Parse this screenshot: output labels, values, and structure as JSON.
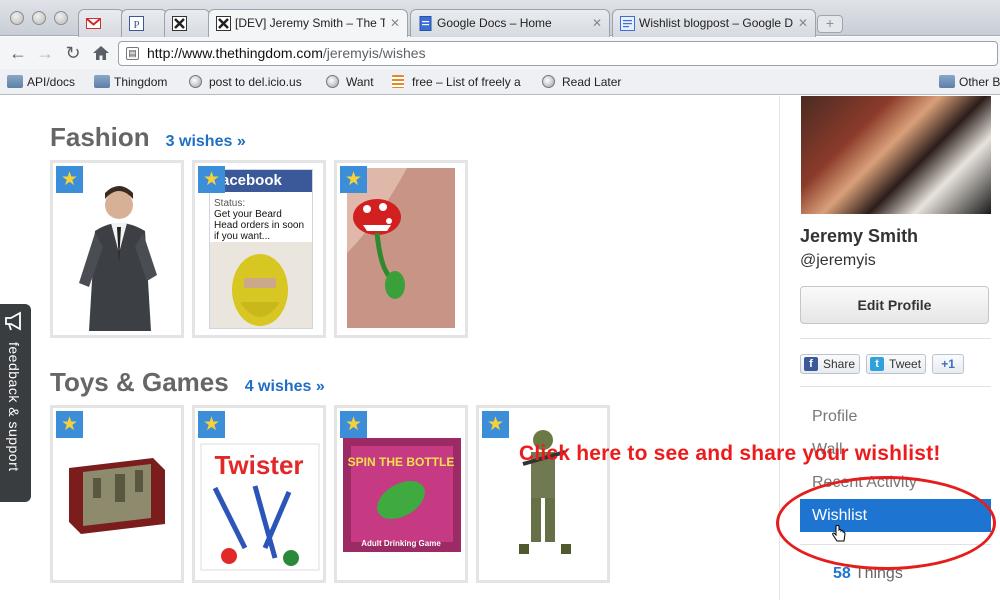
{
  "browser": {
    "tabs": [
      {
        "title": "",
        "icon": "gmail-icon"
      },
      {
        "title": "",
        "icon": "p-icon"
      },
      {
        "title": "",
        "icon": "thingdom-icon"
      },
      {
        "title": "[DEV] Jeremy Smith – The Th",
        "icon": "thingdom-icon",
        "active": true
      },
      {
        "title": "Google Docs – Home",
        "icon": "docs-icon"
      },
      {
        "title": "Wishlist blogpost – Google D",
        "icon": "docs-icon"
      }
    ],
    "url_host": "http://www.thethingdom.com",
    "url_path": "/jeremyis/wishes",
    "bookmarks": [
      {
        "label": "API/docs",
        "icon": "folder-icon"
      },
      {
        "label": "Thingdom",
        "icon": "folder-icon"
      },
      {
        "label": "post to del.icio.us",
        "icon": "globe-icon"
      },
      {
        "label": "Want",
        "icon": "globe-icon"
      },
      {
        "label": "free – List of freely a",
        "icon": "stack-icon"
      },
      {
        "label": "Read Later",
        "icon": "globe-icon"
      },
      {
        "label": "Other B",
        "icon": "folder-icon"
      }
    ]
  },
  "sections": [
    {
      "title": "Fashion",
      "count_label": "3 wishes »",
      "items": 3
    },
    {
      "title": "Toys & Games",
      "count_label": "4 wishes »",
      "items": 4
    }
  ],
  "fashion_items": {
    "facebook_card": {
      "brand": "facebook",
      "status_label": "Status:",
      "status_text": "Get your Beard Head orders in soon if you want..."
    }
  },
  "toys_items": {
    "twister_label": "Twister",
    "bottle_label": "SPIN THE BOTTLE",
    "bottle_sub": "Adult Drinking Game"
  },
  "feedback": {
    "label": "feedback & support"
  },
  "profile": {
    "name": "Jeremy Smith",
    "handle": "@jeremyis",
    "edit_label": "Edit Profile",
    "share_label": "Share",
    "tweet_label": "Tweet",
    "gplus_label": "+1"
  },
  "side_nav": [
    "Profile",
    "Wall",
    "Recent Activity",
    "Wishlist"
  ],
  "things": {
    "count": "58",
    "label": "Things"
  },
  "annotation": {
    "text": "Click here to see and share your wishlist!"
  },
  "colors": {
    "link_blue": "#1f6fc5",
    "active_nav": "#1d74d1",
    "annotation_red": "#ec1c1c",
    "star_bg": "#3d8ed8"
  }
}
